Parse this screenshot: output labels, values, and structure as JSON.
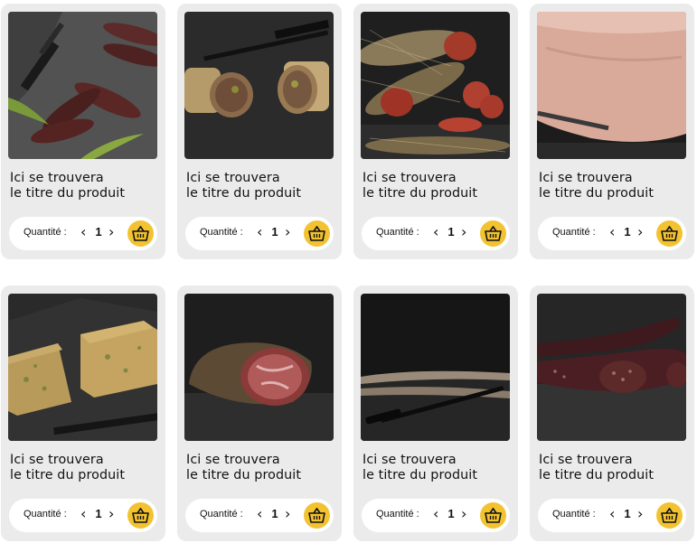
{
  "products": [
    {
      "title_line1": "Ici se trouvera",
      "title_line2": "le titre du produit",
      "qty_label": "Quantité :",
      "qty_value": "1",
      "image": "sausages-knife-photo"
    },
    {
      "title_line1": "Ici se trouvera",
      "title_line2": "le titre du produit",
      "qty_label": "Quantité :",
      "qty_value": "1",
      "image": "pate-roll-photo"
    },
    {
      "title_line1": "Ici se trouvera",
      "title_line2": "le titre du produit",
      "qty_label": "Quantité :",
      "qty_value": "1",
      "image": "netted-salami-photo"
    },
    {
      "title_line1": "Ici se trouvera",
      "title_line2": "le titre du produit",
      "qty_label": "Quantité :",
      "qty_value": "1",
      "image": "ham-block-photo"
    },
    {
      "title_line1": "Ici se trouvera",
      "title_line2": "le titre du produit",
      "qty_label": "Quantité :",
      "qty_value": "1",
      "image": "head-cheese-photo"
    },
    {
      "title_line1": "Ici se trouvera",
      "title_line2": "le titre du produit",
      "qty_label": "Quantité :",
      "qty_value": "1",
      "image": "cured-coppa-photo"
    },
    {
      "title_line1": "Ici se trouvera",
      "title_line2": "le titre du produit",
      "qty_label": "Quantité :",
      "qty_value": "1",
      "image": "dry-sausage-photo"
    },
    {
      "title_line1": "Ici se trouvera",
      "title_line2": "le titre du produit",
      "qty_label": "Quantité :",
      "qty_value": "1",
      "image": "blood-sausage-photo"
    }
  ],
  "icons": {
    "decrement": "chevron-left-icon",
    "increment": "chevron-right-icon",
    "cart": "basket-icon"
  },
  "colors": {
    "card_bg": "#ebebeb",
    "cart_button": "#f2c230",
    "text": "#111111"
  }
}
